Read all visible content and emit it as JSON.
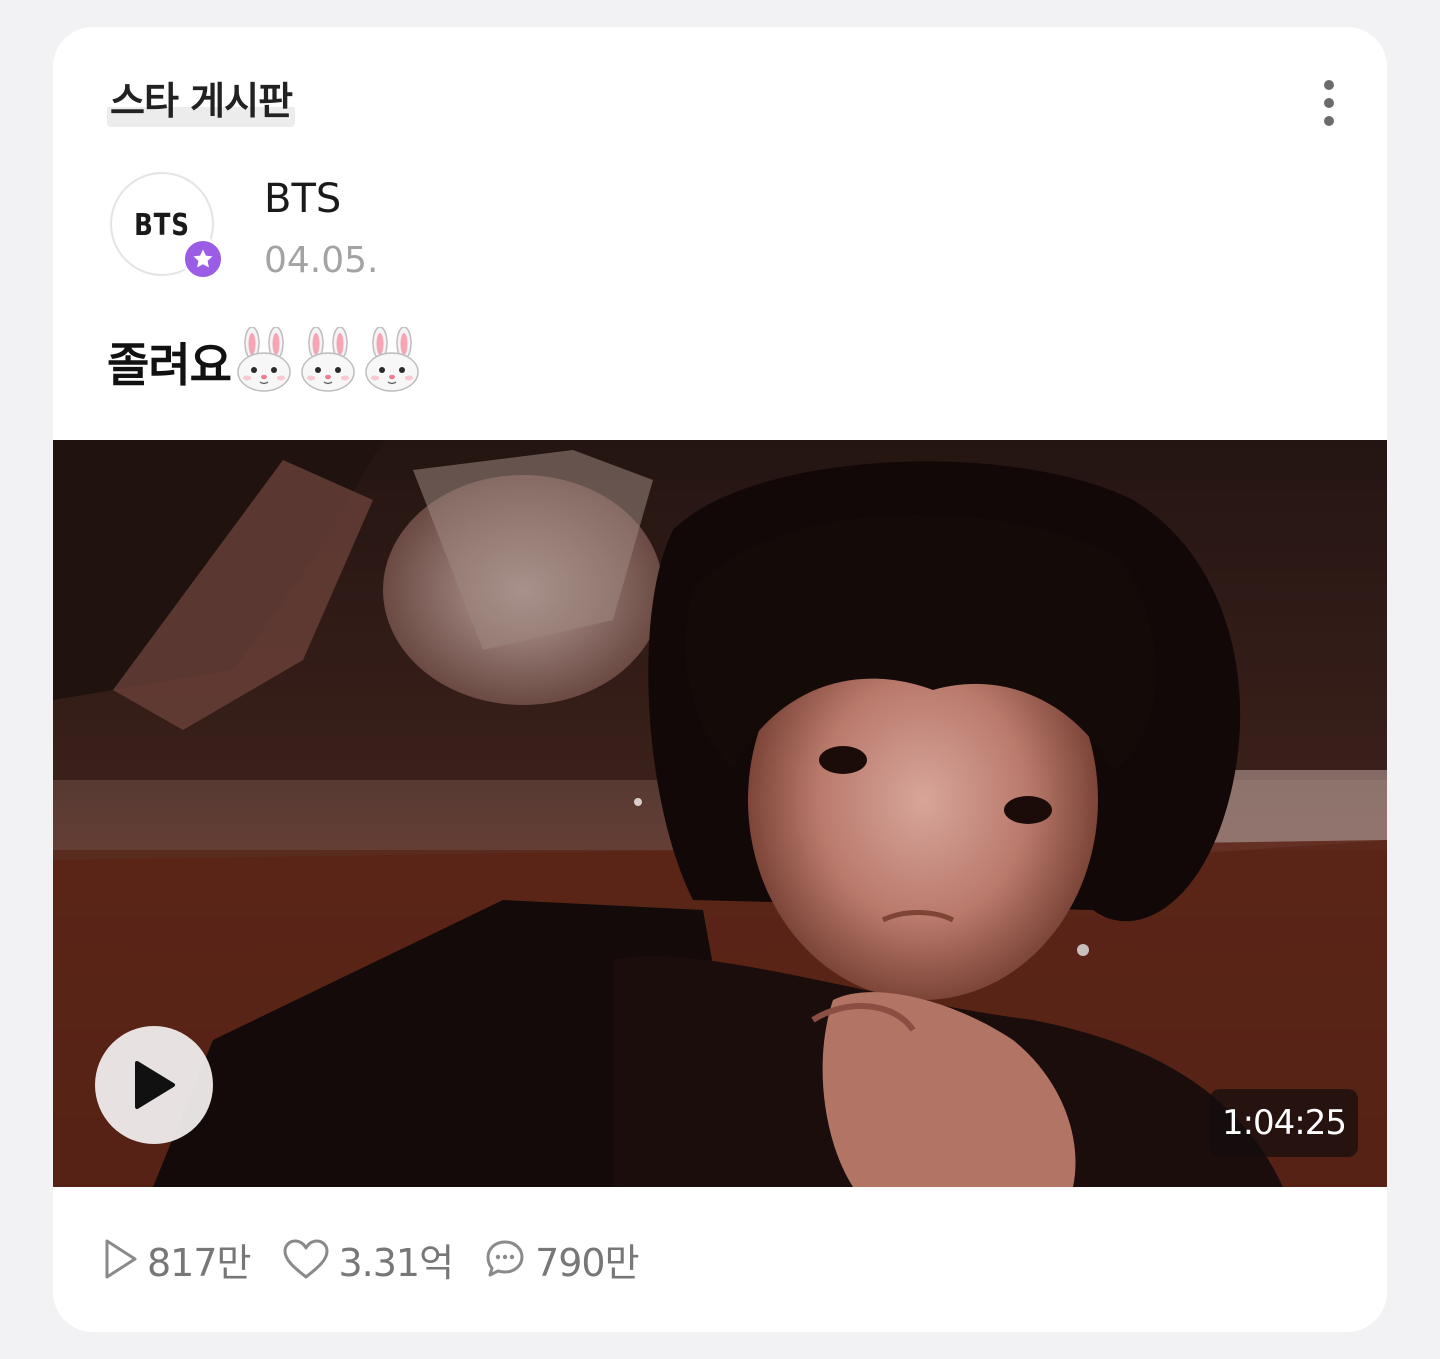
{
  "board": {
    "label": "스타 게시판"
  },
  "post": {
    "author": {
      "avatar_text": "BTS",
      "name": "BTS",
      "badge_icon": "star-icon",
      "badge_color": "#9b5de5"
    },
    "date": "04.05.",
    "text": "졸려요",
    "emoji_count": 3,
    "emoji_name": "rabbit-face-icon"
  },
  "video": {
    "duration": "1:04:25",
    "play_icon": "play-icon"
  },
  "stats": {
    "plays": "817만",
    "likes": "3.31억",
    "comments": "790만"
  },
  "colors": {
    "accent": "#9b5de5",
    "muted_text": "#777777",
    "date_text": "#a3a3a3"
  }
}
